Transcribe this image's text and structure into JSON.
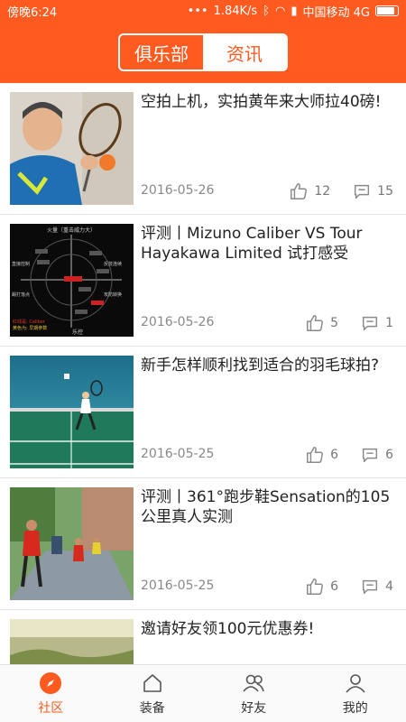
{
  "status_bar": {
    "time": "傍晚6:24",
    "network_speed": "1.84K/s",
    "carrier": "中国移动 4G"
  },
  "header": {
    "tabs": [
      "俱乐部",
      "资讯"
    ],
    "active_tab": "资讯"
  },
  "articles": [
    {
      "title": "空拍上机，实拍黄年来大师拉40磅!",
      "date": "2016-05-26",
      "likes": "12",
      "comments": "15"
    },
    {
      "title": "评测丨Mizuno Caliber VS Tour Hayakawa Limited 试打感受",
      "date": "2016-05-26",
      "likes": "5",
      "comments": "1",
      "thumb_text": {
        "top": "火量（重击威力大）",
        "bottom": "乐控",
        "left1": "直接控制",
        "left2": "踢打落点",
        "right1": "反技连续",
        "right2": "攻防转换",
        "bl1": "红线是: Caliber",
        "bl2": "黄色为: 早期参数"
      }
    },
    {
      "title": "新手怎样顺利找到适合的羽毛球拍?",
      "date": "2016-05-25",
      "likes": "6",
      "comments": "6"
    },
    {
      "title": "评测丨361°跑步鞋Sensation的105公里真人实测",
      "date": "2016-05-25",
      "likes": "6",
      "comments": "4"
    },
    {
      "title": "邀请好友领100元优惠券!",
      "date": "",
      "likes": "",
      "comments": ""
    }
  ],
  "tabbar": [
    {
      "label": "社区",
      "icon": "compass-icon"
    },
    {
      "label": "装备",
      "icon": "home-icon"
    },
    {
      "label": "好友",
      "icon": "friends-icon"
    },
    {
      "label": "我的",
      "icon": "person-icon"
    }
  ],
  "colors": {
    "accent": "#ff5a1f"
  }
}
